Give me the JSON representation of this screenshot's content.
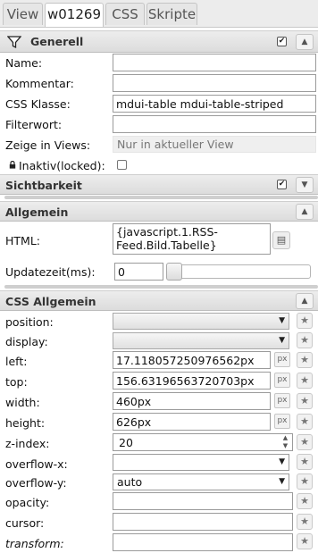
{
  "tabs": [
    {
      "label": "View",
      "active": false
    },
    {
      "label": "w01269",
      "active": true
    },
    {
      "label": "CSS",
      "active": false
    },
    {
      "label": "Skripte",
      "active": false
    }
  ],
  "generell": {
    "title": "Generell",
    "checked": true,
    "fields": {
      "name": {
        "label": "Name:",
        "value": ""
      },
      "kommentar": {
        "label": "Kommentar:",
        "value": ""
      },
      "css_klasse": {
        "label": "CSS Klasse:",
        "value": "mdui-table mdui-table-striped"
      },
      "filterwort": {
        "label": "Filterwort:",
        "value": ""
      },
      "zeige_in_views": {
        "label": "Zeige in Views:",
        "value": "Nur in aktueller View"
      },
      "inaktiv": {
        "label": "Inaktiv(locked):",
        "checked": false
      }
    }
  },
  "sichtbarkeit": {
    "title": "Sichtbarkeit",
    "checked": true
  },
  "allgemein": {
    "title": "Allgemein",
    "html": {
      "label": "HTML:",
      "value": "{javascript.1.RSS-Feed.Bild.Tabelle}"
    },
    "updatezeit": {
      "label": "Updatezeit(ms):",
      "value": "0",
      "slider_fraction": 0
    }
  },
  "css_allgemein": {
    "title": "CSS Allgemein",
    "px_unit": "px",
    "rows": [
      {
        "key": "position",
        "label": "position:",
        "type": "select",
        "value": ""
      },
      {
        "key": "display",
        "label": "display:",
        "type": "select",
        "value": ""
      },
      {
        "key": "left",
        "label": "left:",
        "type": "px",
        "value": "17.118057250976562px"
      },
      {
        "key": "top",
        "label": "top:",
        "type": "px",
        "value": "156.63196563720703px"
      },
      {
        "key": "width",
        "label": "width:",
        "type": "px",
        "value": "460px"
      },
      {
        "key": "height",
        "label": "height:",
        "type": "px",
        "value": "626px"
      },
      {
        "key": "z_index",
        "label": "z-index:",
        "type": "number",
        "value": "20"
      },
      {
        "key": "overflow_x",
        "label": "overflow-x:",
        "type": "select",
        "value": ""
      },
      {
        "key": "overflow_y",
        "label": "overflow-y:",
        "type": "select",
        "value": "auto"
      },
      {
        "key": "opacity",
        "label": "opacity:",
        "type": "text",
        "value": ""
      },
      {
        "key": "cursor",
        "label": "cursor:",
        "type": "text",
        "value": ""
      },
      {
        "key": "transform",
        "label": "transform:",
        "type": "text",
        "value": ""
      }
    ]
  },
  "icons": {
    "filter": "filter-icon",
    "collapse": "chevron-up-icon",
    "expand": "chevron-down-icon",
    "lock": "lock-icon",
    "star": "star-icon",
    "list": "list-icon"
  }
}
